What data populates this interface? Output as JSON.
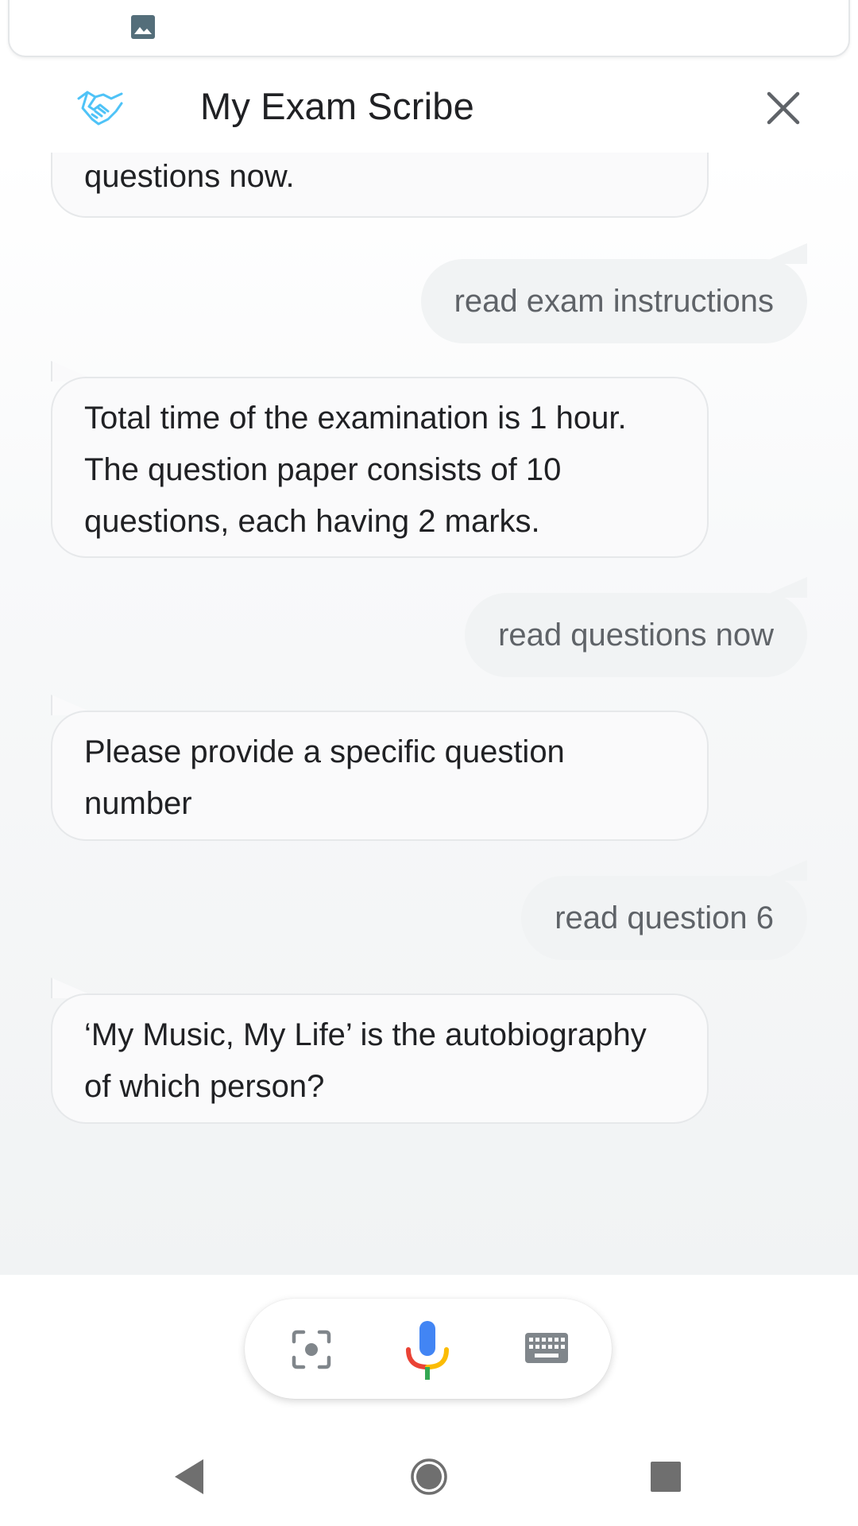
{
  "header": {
    "title": "My Exam Scribe",
    "app_icon": "handshake-icon",
    "close_icon": "close-icon"
  },
  "top_card": {
    "icon": "image-icon"
  },
  "messages": [
    {
      "sender": "assistant",
      "text": "questions now."
    },
    {
      "sender": "user",
      "text": "read exam instructions"
    },
    {
      "sender": "assistant",
      "text": "Total time of the examination is 1 hour. The question paper consists of 10 questions, each having 2 marks."
    },
    {
      "sender": "user",
      "text": "read questions now"
    },
    {
      "sender": "assistant",
      "text": "Please provide a specific question number"
    },
    {
      "sender": "user",
      "text": "read question 6"
    },
    {
      "sender": "assistant",
      "text": "‘My Music, My Life’ is the autobiography of which person?"
    }
  ],
  "input_bar": {
    "icons": [
      "lens-icon",
      "microphone-icon",
      "keyboard-icon"
    ],
    "mic_colors": {
      "blue": "#4285F4",
      "red": "#EA4335",
      "yellow": "#FBBC04",
      "green": "#34A853"
    }
  },
  "navigation": {
    "icons": [
      "back-icon",
      "home-icon",
      "recents-icon"
    ]
  }
}
